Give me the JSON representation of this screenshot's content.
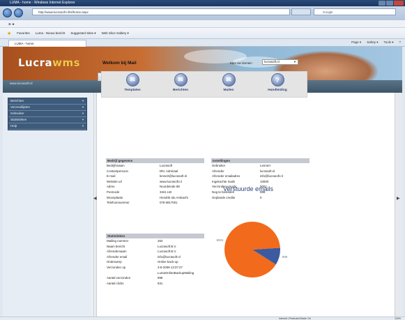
{
  "browser": {
    "title": "LUMA - home - Windows Internet Explorer",
    "address": "http://www.lucrasoft.nl/nl/home.aspx",
    "search_placeholder": "Google",
    "menu": "⊕ ★",
    "favorites_label": "Favorites",
    "fav_links": [
      "Luma - Nieuw bericht",
      "Suggested Sites ▾",
      "Web Slice Gallery ▾"
    ],
    "tab_label": "LUMA - home",
    "commands": [
      "Page ▾",
      "Safety ▾",
      "Tools ▾",
      "?"
    ]
  },
  "page": {
    "logo_a": "Lucra",
    "logo_b": "wms",
    "site_url": "www.lucrasoft.nl",
    "tabs": [
      "Algemeen",
      "Website",
      "Database",
      "Mail"
    ],
    "active_tab": 3,
    "sidebar": [
      "Berichten",
      "Verzendlijsten",
      "Gebruiker",
      "Statistieken",
      "Help"
    ],
    "welcome": "Welkom bij Mail",
    "domain_label": "Kies uw domein",
    "domain_value": "lucrasoft.nl",
    "actions": [
      {
        "label": "Templates",
        "icon": "mail-icon",
        "glyph": "✉"
      },
      {
        "label": "Berichten",
        "icon": "mail-icon",
        "glyph": "✉"
      },
      {
        "label": "Mailen",
        "icon": "mail-icon",
        "glyph": "✉"
      },
      {
        "label": "Handleiding",
        "icon": "help-icon",
        "glyph": "?"
      }
    ]
  },
  "company": {
    "header": "Bedrijf gegevens",
    "rows": [
      {
        "k": "Bedrijfsnaam",
        "v": "Lucrasoft"
      },
      {
        "k": "Contactpersoon",
        "v": "Dhr. Admiraal"
      },
      {
        "k": "E-mail",
        "v": "lennert@lucrasoft.nl"
      },
      {
        "k": "Website url",
        "v": "www.lucrasoft.nl"
      },
      {
        "k": "Adres",
        "v": "Noordeinde 88"
      },
      {
        "k": "Postcode",
        "v": "3341 LW"
      },
      {
        "k": "Woonplaats",
        "v": "Hendrik Ido Ambacht"
      },
      {
        "k": "Telefoonnummer",
        "v": "078 6817001"
      }
    ]
  },
  "settings": {
    "header": "Instellingen",
    "rows": [
      {
        "k": "Gebruiker",
        "v": "Lennert"
      },
      {
        "k": "Afzender",
        "v": "lucrasoft.nl"
      },
      {
        "k": "Afzender emailadres",
        "v": "info@lucrasoft.nl"
      },
      {
        "k": "Ingekochte mails",
        "v": "10000"
      },
      {
        "k": "Verzonden emails",
        "v": "9001"
      },
      {
        "k": "Nog te besteden",
        "v": "999"
      },
      {
        "k": "Geplande credits",
        "v": "0"
      }
    ]
  },
  "stats": {
    "header": "Statistieken",
    "rows": [
      {
        "k": "Mailing nummer",
        "v": "263"
      },
      {
        "k": "Naam bericht",
        "v": "Lucrasoft B.V."
      },
      {
        "k": "Afzendernaam",
        "v": "Lucrasoft B.V."
      },
      {
        "k": "Afzender email",
        "v": "info@lucrasoft.nl"
      },
      {
        "k": "Onderwerp",
        "v": "Online back-up"
      },
      {
        "k": "Verzonden op",
        "v": "3-8-2009 13:37:27"
      },
      {
        "k": "",
        "v": "LumaOnlineBackupMailing"
      },
      {
        "k": "Aantal verzonden",
        "v": "999"
      },
      {
        "k": "Aantal clicks",
        "v": "831"
      }
    ]
  },
  "chart_data": {
    "type": "pie",
    "title": "Verstuurde emails",
    "labels": [
      "9001",
      "999"
    ],
    "values": [
      9001,
      999
    ],
    "colors": [
      "#f26a1b",
      "#3c5aa0"
    ]
  },
  "statusbar": {
    "zone": "Internet | Protected Mode: On",
    "zoom": "100%"
  }
}
